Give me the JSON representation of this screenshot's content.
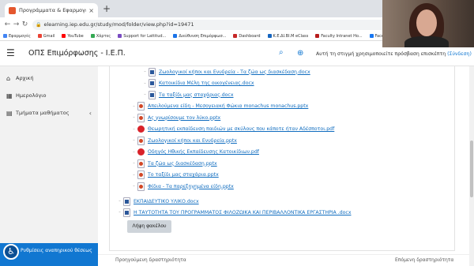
{
  "browser": {
    "tab_title": "Προγράμματα & Εφαρμογές - Ε",
    "tab_close": "×",
    "new_tab": "+",
    "url": "elearning.iep.edu.gr/study/mod/folder/view.php?id=19471",
    "bookmarks": [
      {
        "label": "Εφαρμογές",
        "color": "#4285f4"
      },
      {
        "label": "Gmail",
        "color": "#ea4335"
      },
      {
        "label": "YouTube",
        "color": "#ff0000"
      },
      {
        "label": "Χάρτες",
        "color": "#34a853"
      },
      {
        "label": "Support for Lattitud...",
        "color": "#7a4cc2"
      },
      {
        "label": "Διεύθυνση Επιμόρφωσ...",
        "color": "#1a73e8"
      },
      {
        "label": "Dashboard",
        "color": "#c62828"
      },
      {
        "label": "Κ.Ε.ΔΙ.ΒΙ.Μ eClass",
        "color": "#1565c0"
      },
      {
        "label": "Faculty Intranet Ho...",
        "color": "#b71c1c"
      },
      {
        "label": "Facebook",
        "color": "#1877f2"
      }
    ]
  },
  "navbar": {
    "site_name": "ΟΠΣ Επιμόρφωσης - Ι.Ε.Π.",
    "guest_text": "Αυτή τη στιγμή χρησιμοποιείτε πρόσβαση επισκέπτη",
    "login_link": "(Σύνδεση)"
  },
  "drawer": {
    "items": [
      {
        "label": "Αρχική",
        "icon": "home-icon",
        "glyph": "⌂"
      },
      {
        "label": "Ημερολόγιο",
        "icon": "calendar-icon",
        "glyph": "▦"
      },
      {
        "label": "Τμήματα μαθήματος",
        "icon": "sitemap-icon",
        "glyph": "▤"
      }
    ],
    "accessibility_label": "Ρυθμίσεις αναπηρικού θέσεως"
  },
  "folder": {
    "files": [
      {
        "name": "Ζωολογικοί κήποι και Ενυδρεία - Τα ζώα ως διασκέδαση.docx",
        "type": "docx"
      },
      {
        "name": "Κατοικίδια Μέλη της οικογένειας.docx",
        "type": "docx"
      },
      {
        "name": "Τα ταξίδι μας σταχάριας.docx",
        "type": "docx"
      },
      {
        "name": "Απειλούμενα είδη - Μεσογειακή Φώκια monachus monachus.pptx",
        "type": "pptx"
      },
      {
        "name": "Ας γνωρίσουμε τον λύκο.pptx",
        "type": "pptx"
      },
      {
        "name": "Θεωρητική εκπαίδευση παιδιών με σκύλους που κάποτε ήταν Αδέσποτοι.pdf",
        "type": "pdf"
      },
      {
        "name": "Ζωολογικοί κήποι και Ενυδρεία.pptx",
        "type": "pptx"
      },
      {
        "name": "Οδηγός Ηθικής Εκπαίδευσης Κατοικίδιων.pdf",
        "type": "pdf"
      },
      {
        "name": "Τα ζώα ως διασκέδαση.pptx",
        "type": "pptx"
      },
      {
        "name": "Το ταξίδι μας σταχάρια.pptx",
        "type": "pptx"
      },
      {
        "name": "Φίδια - Τα παρεξηγημένα είδη.pptx",
        "type": "pptx"
      }
    ],
    "root_files": [
      {
        "name": "ΕΚΠΑΙΔΕΥΤΙΚΟ ΥΛΙΚΟ.docx",
        "type": "docx"
      },
      {
        "name": "Η ΤΑΥΤΟΤΗΤΑ ΤΟΥ ΠΡΟΓΡΑΜΜΑΤΟΣ ΦΙΛΟΖΩΙΚΑ ΚΑΙ ΠΕΡΙΒΑΛΛΟΝΤΙΚΑ ΕΡΓΑΣΤΗΡΙΑ .docx",
        "type": "docx"
      }
    ],
    "download_label": "Λήψη φακέλου"
  },
  "footer": {
    "prev": "Προηγούμενη δραστηριότητα",
    "next": "Επόμενη δραστηριότητα"
  }
}
